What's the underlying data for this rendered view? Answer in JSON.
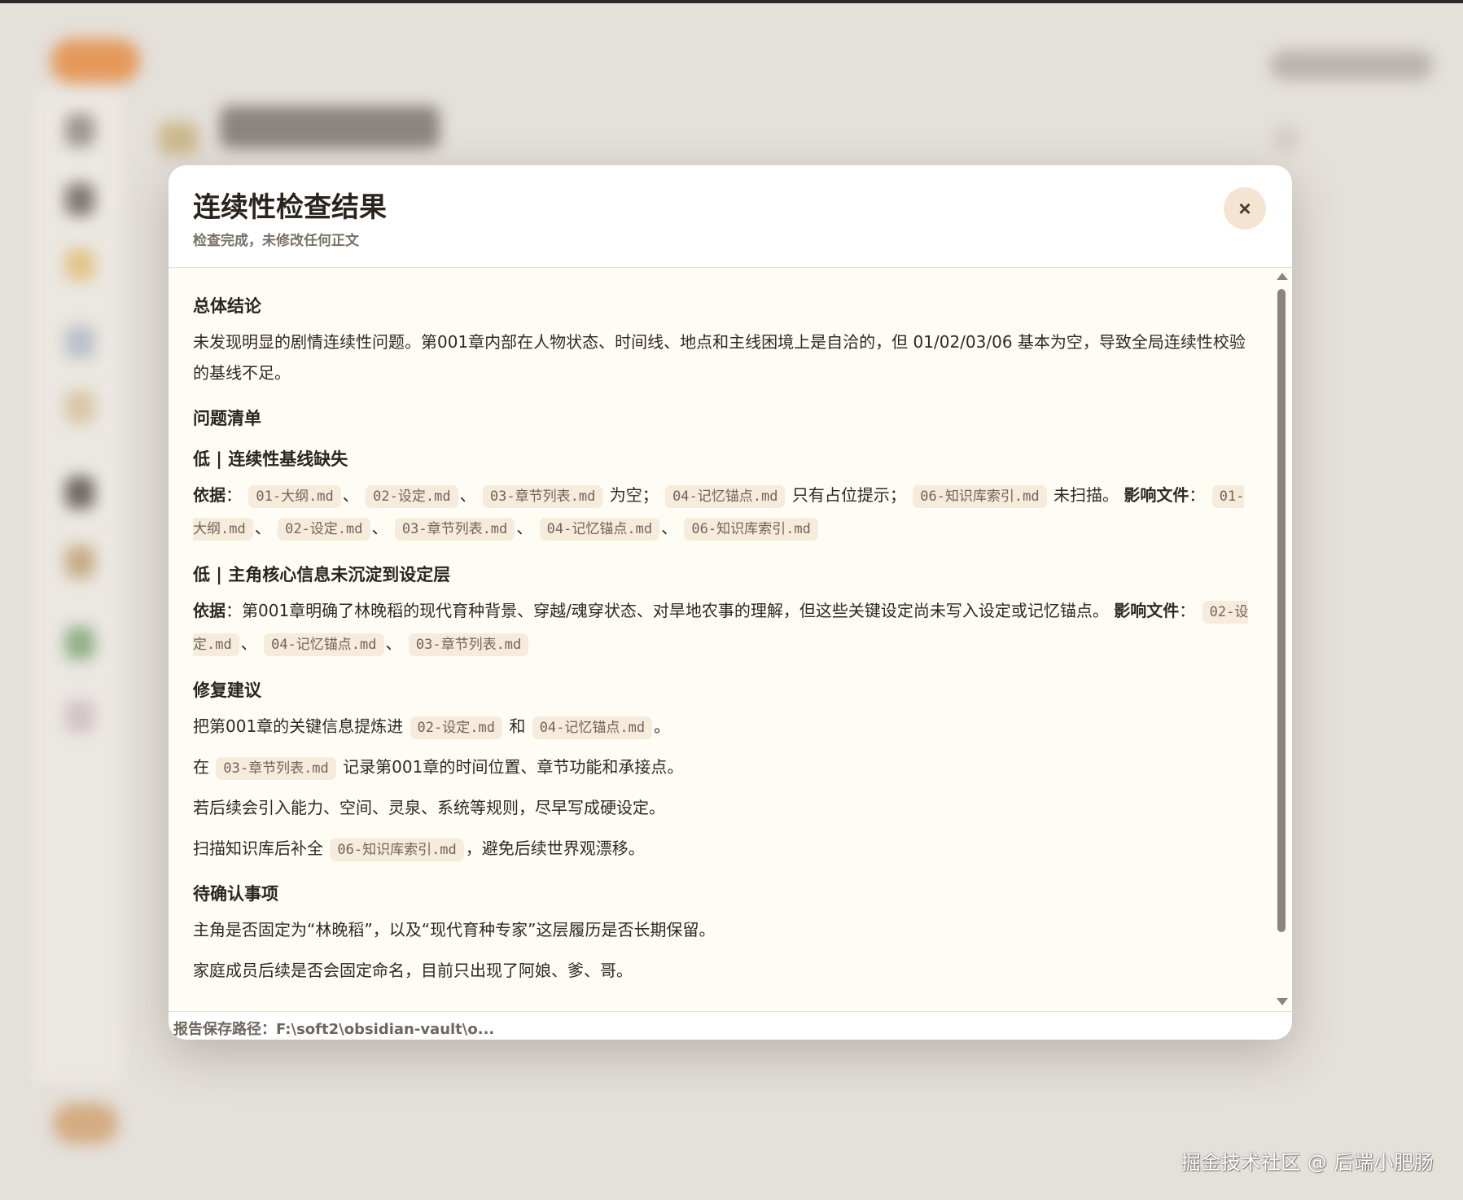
{
  "watermark": "掘金技术社区 @ 后端小肥肠",
  "modal": {
    "title": "连续性检查结果",
    "subtitle": "检查完成，未修改任何正文",
    "close_label": "×",
    "footer_path": "报告保存路径：F:\\soft2\\obsidian-vault\\o..."
  },
  "report": {
    "summary_heading": "总体结论",
    "summary_text": "未发现明显的剧情连续性问题。第001章内部在人物状态、时间线、地点和主线困境上是自洽的，但 01/02/03/06 基本为空，导致全局连续性校验的基线不足。",
    "issues_heading": "问题清单",
    "issue1": {
      "title": "低 | 连续性基线缺失",
      "basis_label": "依据",
      "files": [
        "01-大纲.md",
        "02-设定.md",
        "03-章节列表.md",
        "04-记忆锚点.md",
        "06-知识库索引.md"
      ],
      "text_empty": "为空；",
      "text_placeholder": "只有占位提示；",
      "text_unscanned": "未扫描。",
      "affected_label": "影响文件",
      "affected": [
        "01-大纲.md",
        "02-设定.md",
        "03-章节列表.md",
        "04-记忆锚点.md",
        "06-知识库索引.md"
      ]
    },
    "issue2": {
      "title": "低 | 主角核心信息未沉淀到设定层",
      "basis_label": "依据",
      "basis_text": "第001章明确了林晚稻的现代育种背景、穿越/魂穿状态、对旱地农事的理解，但这些关键设定尚未写入设定或记忆锚点。",
      "affected_label": "影响文件",
      "affected": [
        "02-设定.md",
        "04-记忆锚点.md",
        "03-章节列表.md"
      ]
    },
    "fix_heading": "修复建议",
    "fix1": {
      "pre": "把第001章的关键信息提炼进",
      "file_a": "02-设定.md",
      "mid": "和",
      "file_b": "04-记忆锚点.md",
      "post": "。"
    },
    "fix2": {
      "pre": "在",
      "file": "03-章节列表.md",
      "post": "记录第001章的时间位置、章节功能和承接点。"
    },
    "fix3": "若后续会引入能力、空间、灵泉、系统等规则，尽早写成硬设定。",
    "fix4": {
      "pre": "扫描知识库后补全",
      "file": "06-知识库索引.md",
      "post": "，避免后续世界观漂移。"
    },
    "pending_heading": "待确认事项",
    "pending1": "主角是否固定为“林晚稻”，以及“现代育种专家”这层履历是否长期保留。",
    "pending2": "家庭成员后续是否会固定命名，目前只出现了阿娘、爹、哥。"
  },
  "colors": {
    "accent": "#f6e4d2",
    "code_bg": "#f7ebdc",
    "modal_bg": "#fffcf6"
  }
}
